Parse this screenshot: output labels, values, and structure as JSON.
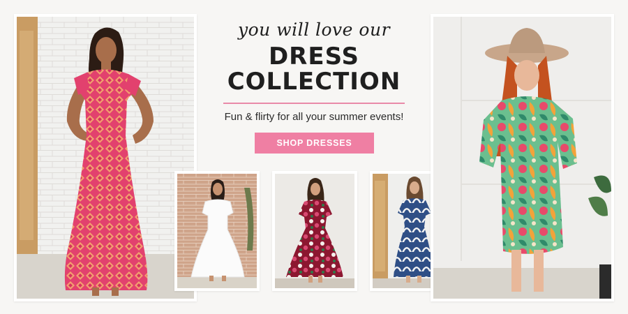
{
  "banner": {
    "script_line": "you will love our",
    "title_line1": "DRESS",
    "title_line2": "COLLECTION",
    "subtitle": "Fun & flirty for all your summer events!",
    "cta_label": "SHOP DRESSES"
  },
  "colors": {
    "background": "#f7f6f4",
    "accent_pink": "#ef7fa3",
    "divider_pink": "#e98aa8",
    "text_dark": "#1f1f1f"
  }
}
